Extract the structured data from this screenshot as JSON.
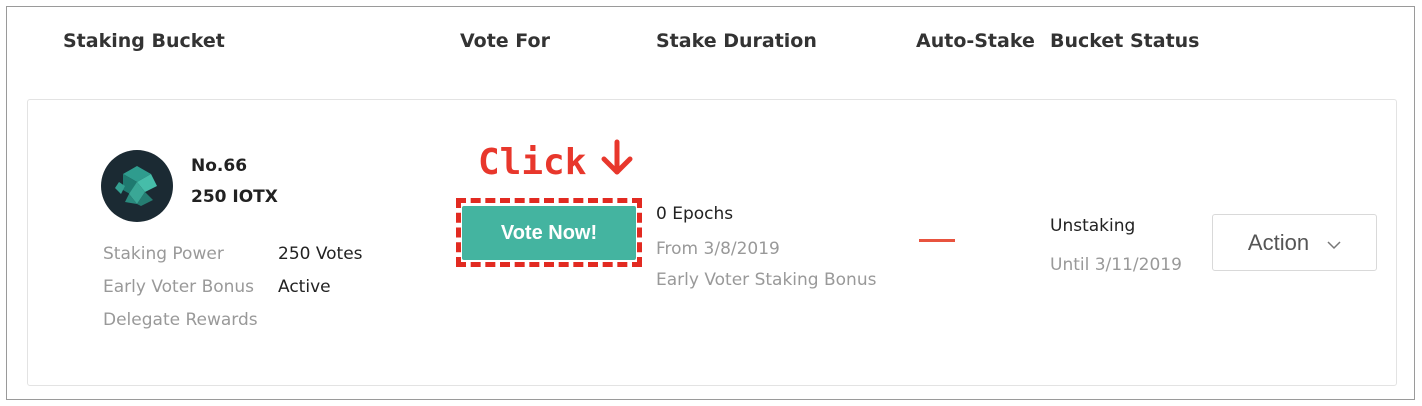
{
  "table": {
    "headers": [
      "Staking Bucket",
      "Vote For",
      "Stake Duration",
      "Auto-Stake",
      "Bucket Status"
    ]
  },
  "bucket": {
    "number": "No.66",
    "amount": "250 IOTX",
    "details": [
      {
        "label": "Staking Power",
        "value": "250 Votes"
      },
      {
        "label": "Early Voter Bonus",
        "value": "Active"
      },
      {
        "label": "Delegate Rewards",
        "value": ""
      }
    ]
  },
  "annotation": {
    "text": "Click"
  },
  "vote": {
    "button_label": "Vote Now!"
  },
  "duration": {
    "epochs": "0 Epochs",
    "from": "From 3/8/2019",
    "bonus": "Early Voter Staking Bonus"
  },
  "status": {
    "state": "Unstaking",
    "until": "Until 3/11/2019"
  },
  "action": {
    "label": "Action"
  },
  "colors": {
    "vote_button": "#44b4a0",
    "annotation_red": "#e22a21",
    "auto_stake_dash": "#e8533f"
  },
  "icons": {
    "avatar": "iotex-logo-icon",
    "annotation_arrow": "arrow-down-icon",
    "dropdown": "chevron-down-icon"
  }
}
